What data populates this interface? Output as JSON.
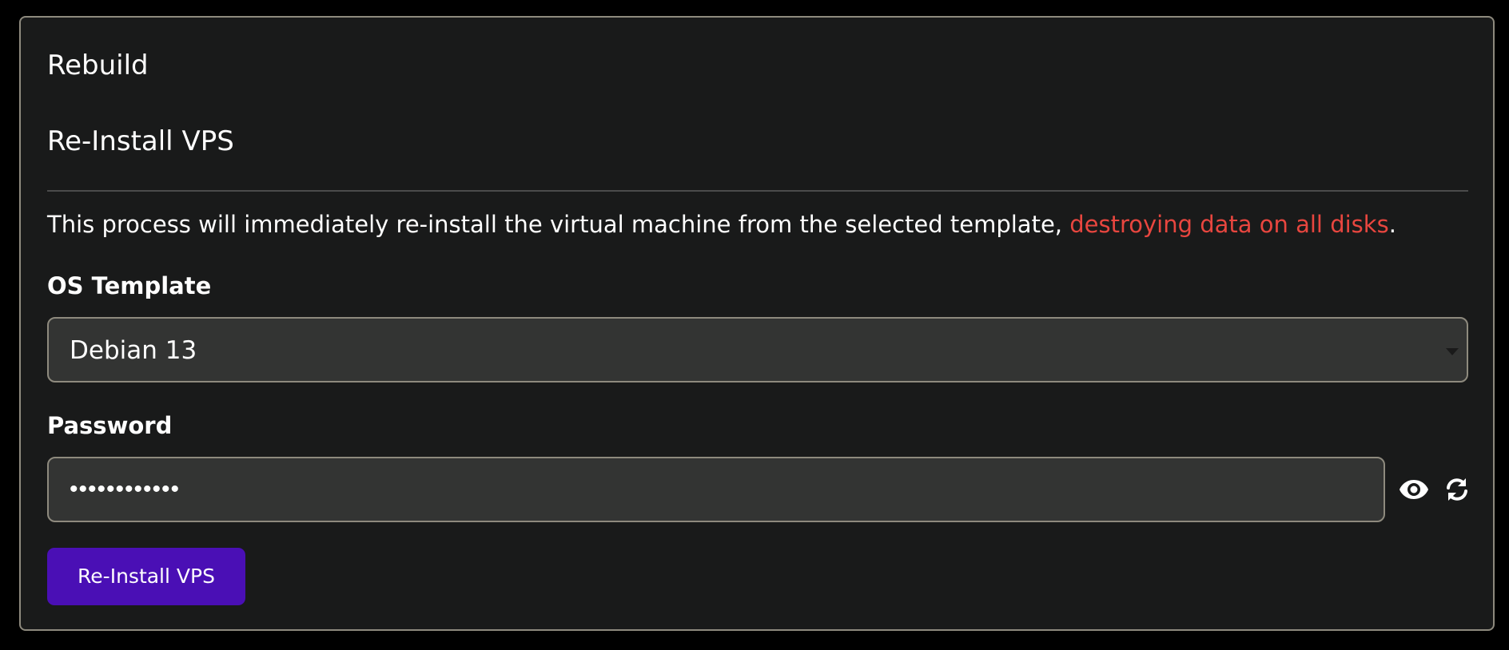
{
  "card": {
    "title": "Rebuild",
    "section_title": "Re-Install VPS",
    "description_prefix": "This process will immediately re-install the virtual machine from the selected template, ",
    "description_warning": "destroying data on all disks",
    "description_suffix": "."
  },
  "os_template": {
    "label": "OS Template",
    "selected": "Debian 13",
    "arrow_icon": "chevron-down-icon"
  },
  "password": {
    "label": "Password",
    "value": "••••••••••••",
    "show_icon": "eye-icon",
    "generate_icon": "refresh-icon"
  },
  "actions": {
    "submit_label": "Re-Install VPS"
  },
  "colors": {
    "background": "#000000",
    "card": "#191a1a",
    "border": "#8e8a7e",
    "input_bg": "#333433",
    "warning": "#e8463f",
    "primary_button": "#4a0fb5"
  }
}
